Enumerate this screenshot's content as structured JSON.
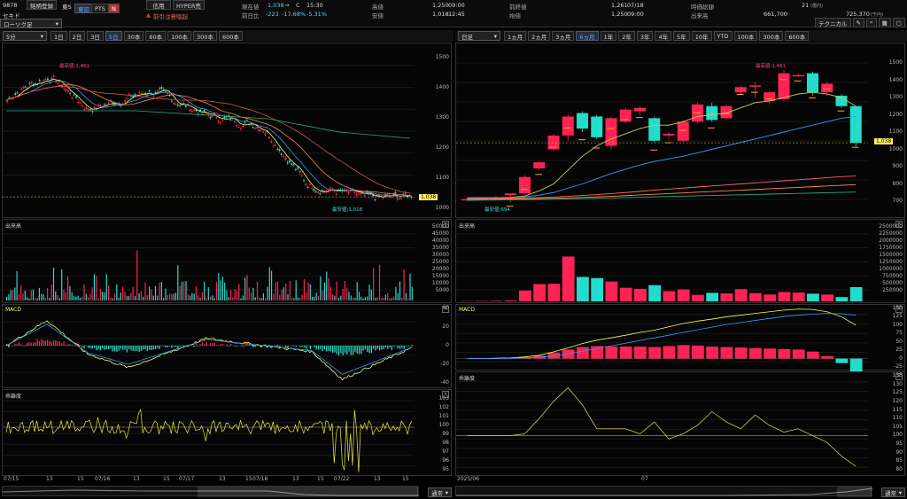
{
  "header": {
    "code": "9878",
    "name": "セキド",
    "reg_label": "銘柄登録",
    "market": "東S",
    "tab_primary": "東証",
    "tab_pts": "PTS",
    "news_icon": "N",
    "credit_label": "信用",
    "hyper_label": "HYPER売",
    "warning": "前引注意喚起",
    "current_price_label": "現在値",
    "current_price": "1,038",
    "current_arrow": "→",
    "current_c": "C",
    "current_time": "15:30",
    "change_label": "前日比",
    "change": "-223",
    "change_pct": "-17.68%",
    "change_pct2": "-5.31%",
    "high_label": "高値",
    "high": "1,250",
    "high_time": "09:00",
    "low_label": "安値",
    "low": "1,018",
    "low_time": "12:45",
    "prev_close_label": "前終値",
    "prev_close": "1,261",
    "prev_close_date": "07/18",
    "open_label": "始値",
    "open": "1,250",
    "open_time": "09:00",
    "market_cap_label": "時価総額",
    "market_cap": "21",
    "market_cap_unit": "(億円)",
    "volume_label": "出来高",
    "volume": "661,700",
    "turnover": "725,370",
    "turnover_unit": "(千円)",
    "technical_label": "テクニカル",
    "chart_type_select": "ローソク足"
  },
  "left_toolbar": {
    "interval": "5分",
    "tabs": [
      "1日",
      "2日",
      "3日",
      "5日",
      "30本",
      "60本",
      "100本",
      "300本",
      "600本"
    ],
    "active": "5日"
  },
  "right_toolbar": {
    "interval": "日足",
    "tabs": [
      "1ヵ月",
      "2ヵ月",
      "3ヵ月",
      "6ヵ月",
      "1年",
      "2年",
      "3年",
      "4年",
      "5年",
      "10年",
      "YTD",
      "100本",
      "300本",
      "600本"
    ],
    "active": "6ヵ月"
  },
  "left_chart": {
    "price_ticks": [
      "1500",
      "1400",
      "1300",
      "1200",
      "1100",
      "1000"
    ],
    "high_note": "最高値;1,461",
    "low_note": "最安値;1,018",
    "last_badge": "1,038",
    "volume_title": "出来高",
    "volume_ticks": [
      "50000",
      "45000",
      "40000",
      "35000",
      "30000",
      "25000",
      "20000",
      "15000",
      "10000",
      "5000"
    ],
    "macd_title": "MACD",
    "macd_ticks": [
      "40",
      "20",
      "0",
      "-20",
      "-40"
    ],
    "psy_title": "乖離度",
    "psy_ticks": [
      "103",
      "102",
      "101",
      "100",
      "99",
      "98",
      "97",
      "96",
      "95"
    ],
    "x_labels": [
      "07/15",
      "13",
      "15",
      "07/16",
      "13",
      "15",
      "07/17",
      "13",
      "15",
      "07/18",
      "13",
      "15",
      "07/22",
      "13",
      "15"
    ],
    "footer_select": "通常"
  },
  "right_chart": {
    "price_ticks": [
      "1500",
      "1400",
      "1300",
      "1200",
      "1100",
      "1000",
      "900",
      "800",
      "700"
    ],
    "high_note": "最高値;1,461",
    "low_note": "最安値;694",
    "last_badge": "1,038",
    "volume_title": "出来高",
    "volume_ticks": [
      "2500000",
      "2250000",
      "2000000",
      "1750000",
      "1500000",
      "1250000",
      "1000000",
      "750000",
      "500000",
      "250000"
    ],
    "macd_title": "MACD",
    "macd_ticks": [
      "150",
      "125",
      "100",
      "75",
      "50",
      "25",
      "0",
      "-25"
    ],
    "psy_title": "乖離度",
    "psy_ticks": [
      "135",
      "130",
      "125",
      "120",
      "115",
      "110",
      "105",
      "100",
      "95",
      "90",
      "85",
      "80"
    ],
    "x_labels": [
      "2025/06",
      "07"
    ],
    "footer_select": "通常"
  },
  "chart_data": [
    {
      "type": "candlestick",
      "timeframe": "5分",
      "summary": {
        "high": 1461,
        "low": 1018,
        "last": 1038
      },
      "ylim": [
        950,
        1550
      ]
    },
    {
      "type": "candlestick",
      "timeframe": "日足",
      "candles": [
        {
          "o": 710,
          "h": 720,
          "l": 705,
          "c": 712
        },
        {
          "o": 712,
          "h": 722,
          "l": 705,
          "c": 715
        },
        {
          "o": 715,
          "h": 730,
          "l": 705,
          "c": 720
        },
        {
          "o": 735,
          "h": 740,
          "l": 694,
          "c": 745
        },
        {
          "o": 745,
          "h": 850,
          "l": 740,
          "c": 840
        },
        {
          "o": 890,
          "h": 930,
          "l": 880,
          "c": 925
        },
        {
          "o": 1000,
          "h": 1090,
          "l": 990,
          "c": 1080
        },
        {
          "o": 1080,
          "h": 1200,
          "l": 1050,
          "c": 1190
        },
        {
          "o": 1210,
          "h": 1220,
          "l": 1100,
          "c": 1120
        },
        {
          "o": 1190,
          "h": 1200,
          "l": 1060,
          "c": 1070
        },
        {
          "o": 1020,
          "h": 1190,
          "l": 1000,
          "c": 1180
        },
        {
          "o": 1160,
          "h": 1240,
          "l": 1150,
          "c": 1230
        },
        {
          "o": 1220,
          "h": 1250,
          "l": 1200,
          "c": 1240
        },
        {
          "o": 1180,
          "h": 1190,
          "l": 1040,
          "c": 1050
        },
        {
          "o": 1080,
          "h": 1100,
          "l": 1060,
          "c": 1090
        },
        {
          "o": 1050,
          "h": 1170,
          "l": 1040,
          "c": 1160
        },
        {
          "o": 1160,
          "h": 1270,
          "l": 1150,
          "c": 1260
        },
        {
          "o": 1250,
          "h": 1270,
          "l": 1160,
          "c": 1170
        },
        {
          "o": 1180,
          "h": 1260,
          "l": 1170,
          "c": 1250
        },
        {
          "o": 1330,
          "h": 1370,
          "l": 1320,
          "c": 1360
        },
        {
          "o": 1370,
          "h": 1390,
          "l": 1300,
          "c": 1370
        },
        {
          "o": 1280,
          "h": 1340,
          "l": 1260,
          "c": 1330
        },
        {
          "o": 1290,
          "h": 1461,
          "l": 1280,
          "c": 1440
        },
        {
          "o": 1430,
          "h": 1440,
          "l": 1420,
          "c": 1430
        },
        {
          "o": 1440,
          "h": 1450,
          "l": 1310,
          "c": 1330
        },
        {
          "o": 1330,
          "h": 1390,
          "l": 1310,
          "c": 1380
        },
        {
          "o": 1310,
          "h": 1320,
          "l": 1240,
          "c": 1250
        },
        {
          "o": 1250,
          "h": 1250,
          "l": 1018,
          "c": 1038
        }
      ],
      "volume": [
        10000,
        15000,
        20000,
        30000,
        380000,
        610000,
        620000,
        1580000,
        860000,
        820000,
        700000,
        480000,
        440000,
        570000,
        360000,
        420000,
        230000,
        300000,
        280000,
        430000,
        290000,
        240000,
        330000,
        310000,
        270000,
        240000,
        150000,
        500000
      ],
      "summary": {
        "high": 1461,
        "low": 694,
        "last": 1038
      },
      "ylim": [
        650,
        1550
      ]
    }
  ]
}
